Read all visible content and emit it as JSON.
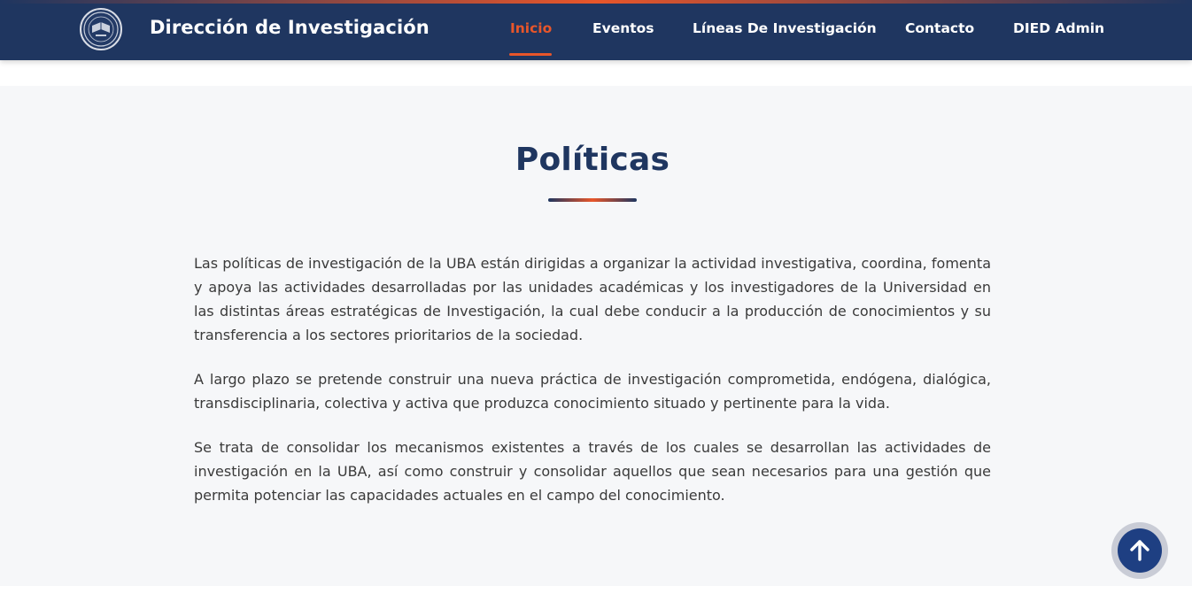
{
  "header": {
    "site_title": "Dirección de Investigación",
    "logo_icon": "university-seal-icon",
    "nav": [
      {
        "label": "Inicio",
        "active": true
      },
      {
        "label": "Eventos",
        "active": false
      },
      {
        "label": "Líneas De Investigación",
        "active": false
      },
      {
        "label": "Contacto",
        "active": false
      },
      {
        "label": "DIED Admin",
        "active": false
      }
    ]
  },
  "main": {
    "title": "Políticas",
    "paragraphs": [
      "Las políticas de investigación de la UBA están dirigidas a organizar la actividad investigativa, coordina, fomenta y apoya las actividades desarrolladas por las unidades académicas y los investigadores de la Universidad en las distintas áreas estratégicas de Investigación, la cual debe conducir a la producción de conocimientos y su transferencia a los sectores prioritarios de la sociedad.",
      "A largo plazo se pretende construir una nueva práctica de investigación comprometida, endógena, dialógica, transdisciplinaria, colectiva y activa que produzca conocimiento situado y pertinente para la vida.",
      "Se trata de consolidar los mecanismos existentes a través de los cuales se desarrollan las actividades de investigación en la UBA, así como construir y consolidar aquellos que sean necesarios para una gestión que permita potenciar las capacidades actuales en el campo del conocimiento."
    ]
  },
  "back_to_top": {
    "icon": "arrow-up-icon"
  },
  "colors": {
    "navy": "#1f3660",
    "accent_orange": "#e8562a",
    "section_bg": "#f6f7f9",
    "body_text": "#3a3a3a",
    "button_blue": "#1e3f82"
  }
}
